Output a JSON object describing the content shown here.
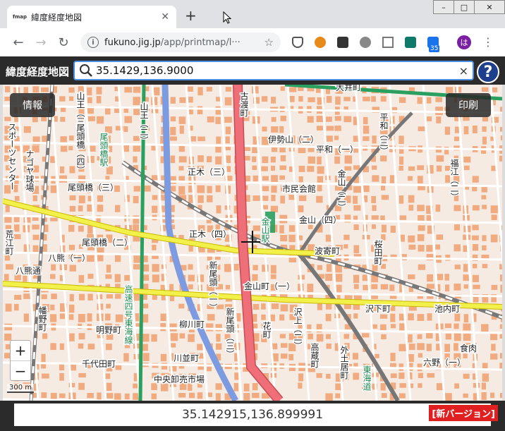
{
  "browser": {
    "tab_title": "緯度経度地図",
    "favicon_text": "fmap",
    "new_tab": "+",
    "url_host": "fukuno.jig.jp",
    "url_path": "/app/printmap/l···",
    "ext_badge": "35",
    "profile_initial": "は",
    "window_controls": [
      "–",
      "□",
      "✕"
    ]
  },
  "app": {
    "title": "緯度経度地図",
    "search_value": "35.1429,136.9000",
    "clear_label": "×",
    "help_label": "?",
    "info_button": "情報",
    "print_button": "印刷",
    "zoom_in": "+",
    "zoom_out": "−",
    "scale": "300 m",
    "coordinates": "35.142915,136.899991",
    "new_version": "[新バージョン]"
  },
  "map": {
    "colors": {
      "background": "#f6ebe3",
      "building": "#f0a070",
      "road_major": "#ef6f78",
      "road_yellow": "#f2f04a",
      "rail_green": "#2aa060",
      "expressway": "#7c9be0",
      "label": "#222222"
    },
    "labels": [
      "山王（三）",
      "山王（二）",
      "古渡町",
      "大井町",
      "平和（三）",
      "尾頭橋（四）",
      "伊勢山（二）",
      "平和（一）",
      "正木（三）",
      "金山（二）",
      "福江（二）",
      "尾頭橋（三）",
      "市民会館",
      "金山（四）",
      "尾頭橋（二）",
      "正木（四）",
      "波寄町",
      "桜田町",
      "八熊（一）",
      "新尾頭（一）",
      "金山町（一）",
      "高速四号東海線",
      "柳川町",
      "沢上（二）",
      "沢下町",
      "池内町",
      "明野町",
      "新尾頭（三）",
      "花町",
      "高蔵町",
      "千代田町",
      "川並町",
      "中央卸売市場",
      "六野（一）",
      "東海道",
      "金山駅",
      "尾頭橋駅",
      "スポーツセンター",
      "ナゴヤ球場",
      "荒江町",
      "幡野町",
      "八熊通",
      "外土居町",
      "食肉"
    ]
  }
}
